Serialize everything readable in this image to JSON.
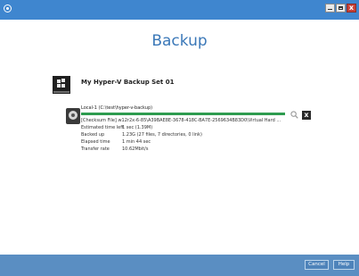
{
  "window": {
    "title_text": "",
    "minimize_glyph": "—",
    "maximize_glyph": "□",
    "close_glyph": "x",
    "colors": {
      "titlebar": "#3f86cf",
      "footer": "#5a8ec2",
      "progress": "#2e9c4f",
      "title_text": "#3b78b8"
    }
  },
  "page": {
    "title": "Backup"
  },
  "backup_set": {
    "name": "My Hyper-V Backup Set 01",
    "icon": "hyperv-windows-icon"
  },
  "job": {
    "destination": "Local-1 (C:\\test\\hyper-v-backup)",
    "progress_fraction": 1.0,
    "status": "[Checksum File] w12r2x-6-85\\A39BAE8E-3678-418C-BA7E-2569634B83D0\\Virtual Hard ...",
    "stats": [
      {
        "label": "Estimated time left",
        "value": "1 sec (1.39M)"
      },
      {
        "label": "Backed up",
        "value": "1.23G (27 files, 7 directories, 0 link)"
      },
      {
        "label": "Elapsed time",
        "value": "1 min 44 sec"
      },
      {
        "label": "Transfer rate",
        "value": "10.62Mbit/s"
      }
    ],
    "stop_glyph": "x"
  },
  "footer": {
    "cancel_label": "Cancel",
    "help_label": "Help"
  }
}
